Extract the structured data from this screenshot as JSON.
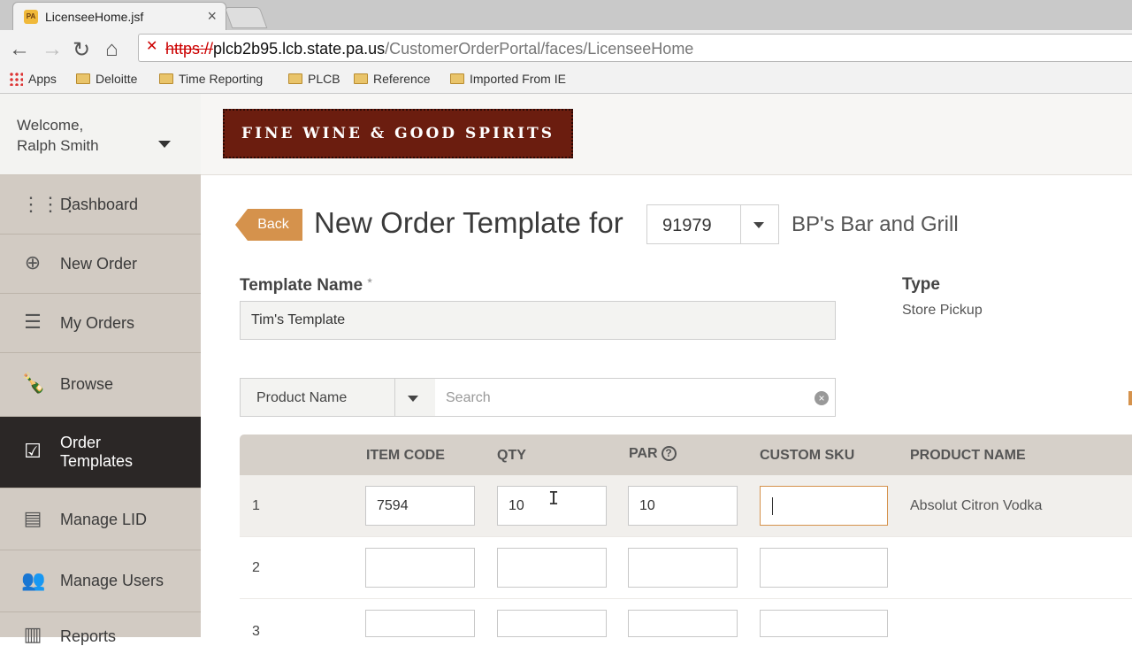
{
  "browser": {
    "tab_title": "LicenseeHome.jsf",
    "tab_favicon": "PA",
    "url_scheme": "https://",
    "url_host": "plcb2b95.lcb.state.pa.us",
    "url_path": "/CustomerOrderPortal/faces/LicenseeHome",
    "bookmarks": [
      "Apps",
      "Deloitte",
      "Time Reporting",
      "PLCB",
      "Reference",
      "Imported From IE"
    ]
  },
  "sidebar": {
    "welcome_line1": "Welcome,",
    "welcome_line2": "Ralph Smith",
    "items": [
      {
        "label": "Dashboard",
        "icon": "grid-icon"
      },
      {
        "label": "New Order",
        "icon": "plus-circle-icon"
      },
      {
        "label": "My Orders",
        "icon": "list-icon"
      },
      {
        "label": "Browse",
        "icon": "bottles-icon"
      },
      {
        "label": "Order",
        "label2": "Templates",
        "icon": "checkbox-icon"
      },
      {
        "label": "Manage LID",
        "icon": "id-card-icon"
      },
      {
        "label": "Manage Users",
        "icon": "users-icon"
      },
      {
        "label": "Reports",
        "icon": "chart-icon"
      }
    ]
  },
  "brand": {
    "logo_text": "FINE WINE & GOOD SPIRITS",
    "accent": "#d5924c",
    "logo_color": "#6b1d0f"
  },
  "header": {
    "back_label": "Back",
    "title": "New Order Template for",
    "lid_value": "91979",
    "licensee_name": "BP's Bar and Grill"
  },
  "form": {
    "template_name_label": "Template Name",
    "required_mark": "*",
    "template_name_value": "Tim's Template",
    "type_label": "Type",
    "type_value": "Store Pickup"
  },
  "search": {
    "filter_value": "Product Name",
    "placeholder": "Search"
  },
  "grid": {
    "headers": [
      "ITEM CODE",
      "QTY",
      "PAR",
      "CUSTOM SKU",
      "PRODUCT NAME"
    ],
    "rows": [
      {
        "num": "1",
        "item_code": "7594",
        "qty": "10",
        "par": "10",
        "custom_sku": "",
        "product_name": "Absolut Citron Vodka"
      },
      {
        "num": "2",
        "item_code": "",
        "qty": "",
        "par": "",
        "custom_sku": "",
        "product_name": ""
      },
      {
        "num": "3",
        "item_code": "",
        "qty": "",
        "par": "",
        "custom_sku": "",
        "product_name": ""
      }
    ]
  }
}
